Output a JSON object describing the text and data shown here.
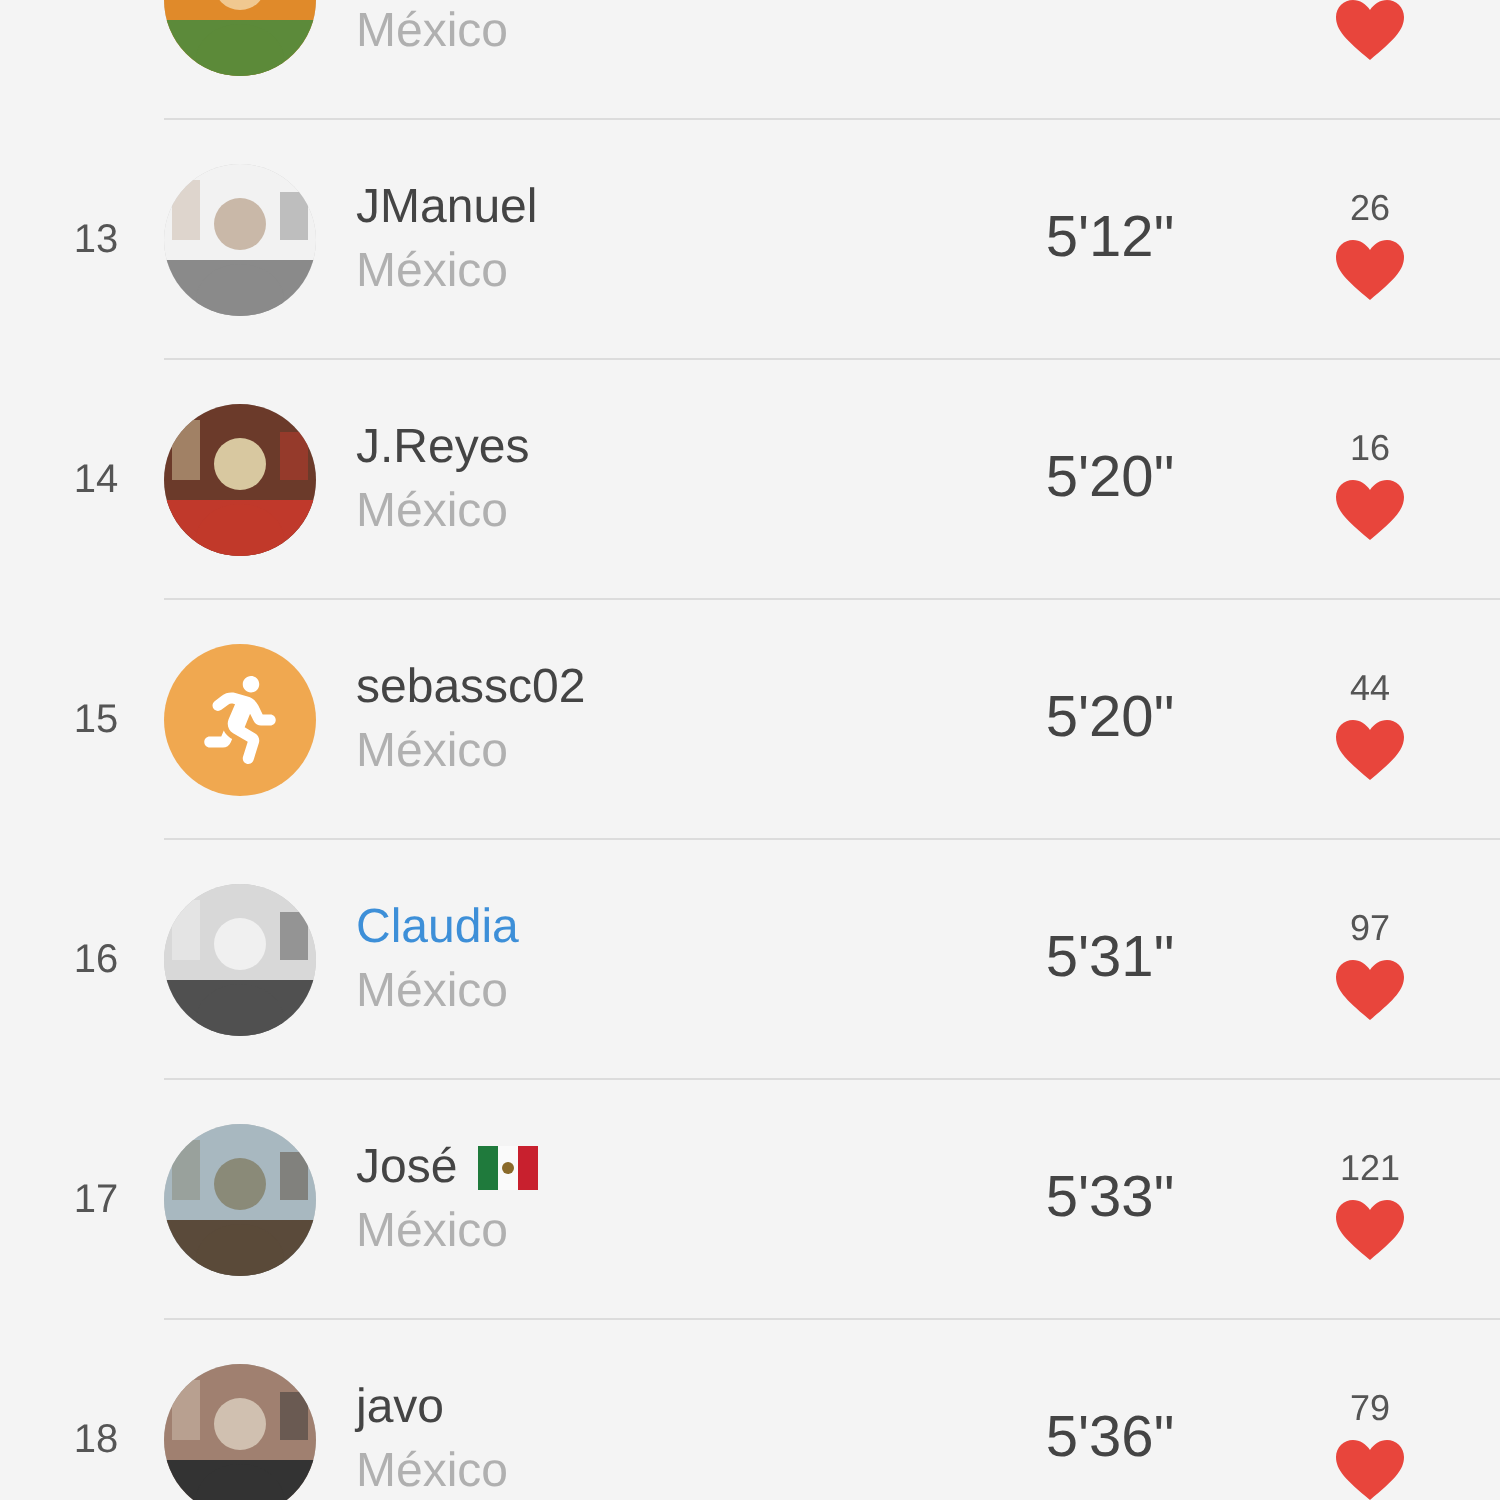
{
  "rows": [
    {
      "rank": null,
      "name": null,
      "country": "México",
      "time": null,
      "likes": null,
      "flag": false
    },
    {
      "rank": "13",
      "name": "JManuel",
      "country": "México",
      "time": "5'12\"",
      "likes": "26",
      "flag": false
    },
    {
      "rank": "14",
      "name": "J.Reyes",
      "country": "México",
      "time": "5'20\"",
      "likes": "16",
      "flag": false
    },
    {
      "rank": "15",
      "name": "sebassc02",
      "country": "México",
      "time": "5'20\"",
      "likes": "44",
      "avatar": {
        "kind": "runner"
      },
      "flag": false
    },
    {
      "rank": "16",
      "name": "Claudia",
      "country": "México",
      "time": "5'31\"",
      "likes": "97",
      "flag": false,
      "highlighted": true
    },
    {
      "rank": "17",
      "name": "José",
      "country": "México",
      "time": "5'33\"",
      "likes": "121",
      "flag": true
    },
    {
      "rank": "18",
      "name": "javo",
      "country": "México",
      "time": "5'36\"",
      "likes": "79",
      "flag": false
    }
  ]
}
